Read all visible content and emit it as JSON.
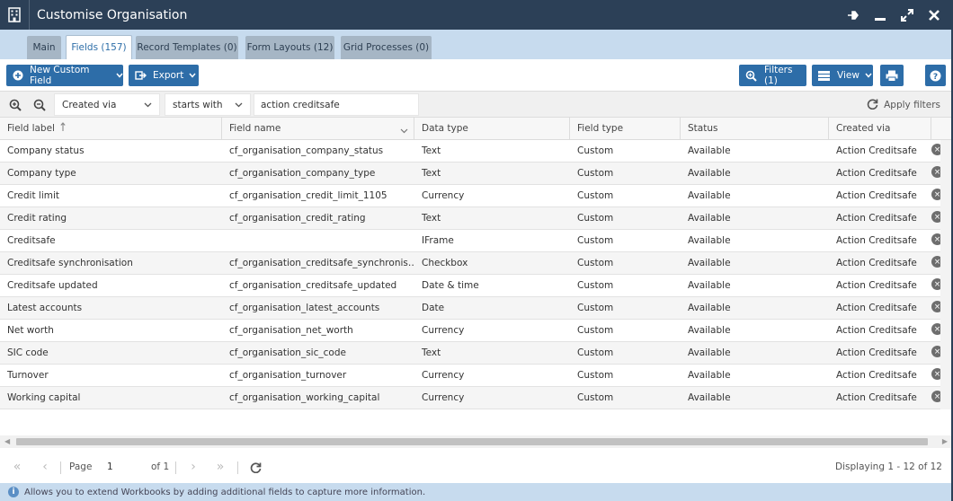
{
  "window": {
    "title": "Customise Organisation",
    "icon": "building-icon"
  },
  "window_controls": [
    "pin-icon",
    "minimize-icon",
    "maximize-icon",
    "close-icon"
  ],
  "tabs": [
    {
      "label": "Main",
      "active": false
    },
    {
      "label": "Fields (157)",
      "active": true
    },
    {
      "label": "Record Templates (0)",
      "active": false
    },
    {
      "label": "Form Layouts (12)",
      "active": false
    },
    {
      "label": "Grid Processes (0)",
      "active": false
    }
  ],
  "toolbar": {
    "new_field_label": "New Custom Field",
    "export_label": "Export",
    "filters_label": "Filters (1)",
    "view_label": "View"
  },
  "filter": {
    "column": "Created via",
    "operator": "starts with",
    "value": "action creditsafe",
    "apply_label": "Apply filters"
  },
  "columns": [
    "Field label",
    "Field name",
    "Data type",
    "Field type",
    "Status",
    "Created via"
  ],
  "sort": {
    "column": "Field label",
    "direction": "ascending"
  },
  "rows": [
    {
      "label": "Company status",
      "name": "cf_organisation_company_status",
      "data_type": "Text",
      "field_type": "Custom",
      "status": "Available",
      "created_via": "Action Creditsafe"
    },
    {
      "label": "Company type",
      "name": "cf_organisation_company_type",
      "data_type": "Text",
      "field_type": "Custom",
      "status": "Available",
      "created_via": "Action Creditsafe"
    },
    {
      "label": "Credit limit",
      "name": "cf_organisation_credit_limit_1105",
      "data_type": "Currency",
      "field_type": "Custom",
      "status": "Available",
      "created_via": "Action Creditsafe"
    },
    {
      "label": "Credit rating",
      "name": "cf_organisation_credit_rating",
      "data_type": "Text",
      "field_type": "Custom",
      "status": "Available",
      "created_via": "Action Creditsafe"
    },
    {
      "label": "Creditsafe",
      "name": "",
      "data_type": "IFrame",
      "field_type": "Custom",
      "status": "Available",
      "created_via": "Action Creditsafe"
    },
    {
      "label": "Creditsafe synchronisation",
      "name": "cf_organisation_creditsafe_synchronis…",
      "data_type": "Checkbox",
      "field_type": "Custom",
      "status": "Available",
      "created_via": "Action Creditsafe"
    },
    {
      "label": "Creditsafe updated",
      "name": "cf_organisation_creditsafe_updated",
      "data_type": "Date & time",
      "field_type": "Custom",
      "status": "Available",
      "created_via": "Action Creditsafe"
    },
    {
      "label": "Latest accounts",
      "name": "cf_organisation_latest_accounts",
      "data_type": "Date",
      "field_type": "Custom",
      "status": "Available",
      "created_via": "Action Creditsafe"
    },
    {
      "label": "Net worth",
      "name": "cf_organisation_net_worth",
      "data_type": "Currency",
      "field_type": "Custom",
      "status": "Available",
      "created_via": "Action Creditsafe"
    },
    {
      "label": "SIC code",
      "name": "cf_organisation_sic_code",
      "data_type": "Text",
      "field_type": "Custom",
      "status": "Available",
      "created_via": "Action Creditsafe"
    },
    {
      "label": "Turnover",
      "name": "cf_organisation_turnover",
      "data_type": "Currency",
      "field_type": "Custom",
      "status": "Available",
      "created_via": "Action Creditsafe"
    },
    {
      "label": "Working capital",
      "name": "cf_organisation_working_capital",
      "data_type": "Currency",
      "field_type": "Custom",
      "status": "Available",
      "created_via": "Action Creditsafe"
    }
  ],
  "pager": {
    "page_label": "Page",
    "page_value": "1",
    "of_label": "of 1",
    "displaying": "Displaying 1 - 12 of 12"
  },
  "status": {
    "message": "Allows you to extend Workbooks by adding additional fields to capture more information."
  }
}
